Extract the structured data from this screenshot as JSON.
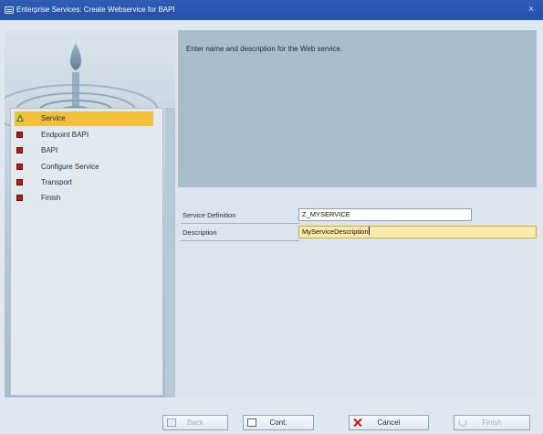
{
  "window": {
    "title": "Enterprise Services: Create Webservice for BAPI"
  },
  "wizard": {
    "instruction": "Enter name and description for the Web service.",
    "steps": [
      {
        "label": "Service",
        "active": true,
        "icon": "current-step-triangle-icon"
      },
      {
        "label": "Endpoint BAPI",
        "active": false,
        "icon": "pending-step-icon"
      },
      {
        "label": "BAPI",
        "active": false,
        "icon": "pending-step-icon"
      },
      {
        "label": "Configure Service",
        "active": false,
        "icon": "pending-step-icon"
      },
      {
        "label": "Transport",
        "active": false,
        "icon": "pending-step-icon"
      },
      {
        "label": "Finish",
        "active": false,
        "icon": "pending-step-icon"
      }
    ]
  },
  "form": {
    "service_definition_label": "Service Definition",
    "service_definition_value": "Z_MYSERVICE",
    "description_label": "Description",
    "description_value": "MyServiceDescription"
  },
  "buttons": {
    "back": "Back",
    "cont": "Cont.",
    "cancel": "Cancel",
    "finish": "Finish"
  },
  "colors": {
    "titlebar": "#2350a8",
    "active_step": "#f2bf3a",
    "focus_field": "#fbeaa8",
    "step_icon": "#b81a1a"
  }
}
